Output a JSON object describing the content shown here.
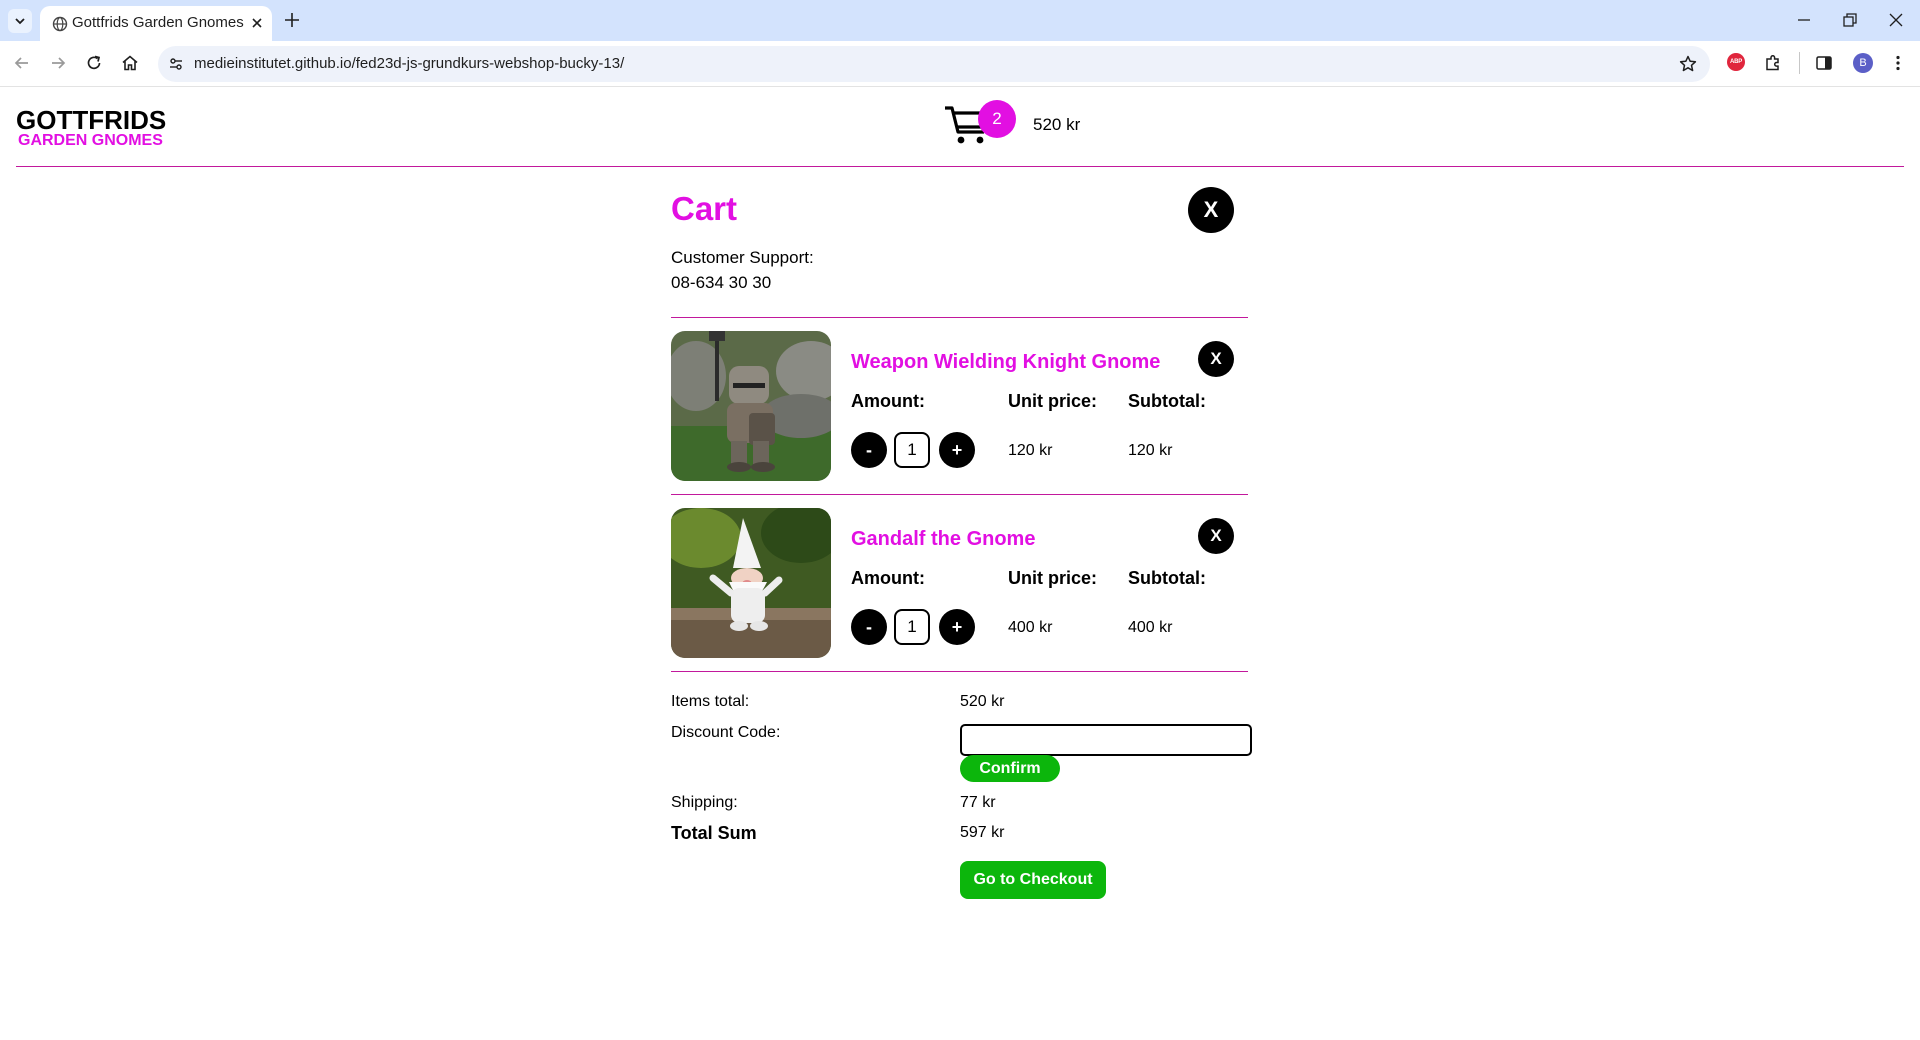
{
  "browser": {
    "tab_title": "Gottfrids Garden Gnomes",
    "url": "medieinstitutet.github.io/fed23d-js-grundkurs-webshop-bucky-13/",
    "profile_initial": "B",
    "abp_label": "ABP"
  },
  "header": {
    "logo_line1": "GOTTFRIDS",
    "logo_line2": "GARDEN GNOMES",
    "cart_count": "2",
    "cart_sum": "520 kr"
  },
  "cart": {
    "title": "Cart",
    "close_label": "X",
    "support_label": "Customer Support:",
    "support_phone": "08-634 30 30",
    "items": [
      {
        "name": "Weapon Wielding Knight Gnome",
        "remove_label": "X",
        "amount_label": "Amount:",
        "unit_price_label": "Unit price:",
        "subtotal_label": "Subtotal:",
        "minus_label": "-",
        "quantity": "1",
        "plus_label": "+",
        "unit_price": "120 kr",
        "subtotal": "120 kr"
      },
      {
        "name": "Gandalf the Gnome",
        "remove_label": "X",
        "amount_label": "Amount:",
        "unit_price_label": "Unit price:",
        "subtotal_label": "Subtotal:",
        "minus_label": "-",
        "quantity": "1",
        "plus_label": "+",
        "unit_price": "400 kr",
        "subtotal": "400 kr"
      }
    ],
    "summary": {
      "items_total_label": "Items total:",
      "items_total": "520 kr",
      "discount_label": "Discount Code:",
      "discount_value": "",
      "confirm_label": "Confirm",
      "shipping_label": "Shipping:",
      "shipping": "77 kr",
      "total_label": "Total Sum",
      "total": "597 kr",
      "checkout_label": "Go to Checkout"
    }
  },
  "colors": {
    "accent": "#e20fe2",
    "divider": "#c2189c",
    "button_green": "#0cb60c",
    "tabbar": "#d3e3fd"
  }
}
